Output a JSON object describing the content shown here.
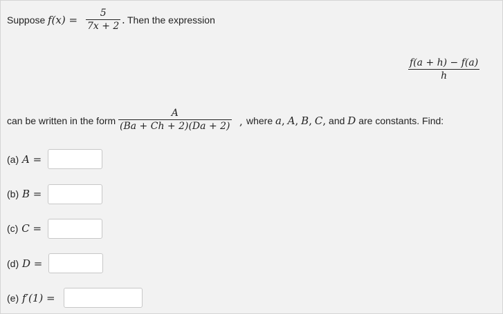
{
  "intro": {
    "text_suppose": "Suppose",
    "f_of_x": "f(x) =",
    "f_numerator": "5",
    "f_denominator": "7x + 2",
    "period": ".",
    "text_then": "Then the expression"
  },
  "expression": {
    "numerator": "f(a + h) − f(a)",
    "denominator": "h"
  },
  "form": {
    "text_can_be": "can be written in the form",
    "numerator": "A",
    "denominator": "(Ba + Ch + 2)(Da + 2)",
    "comma": ",",
    "text_where": "where",
    "var_a": "a",
    "var_A": "A",
    "var_B": "B",
    "var_C": "C",
    "var_D": "D",
    "sep1": ",",
    "sep2": ",",
    "sep3": ",",
    "text_and": "and",
    "text_constants": "are constants. Find:"
  },
  "parts": [
    {
      "prefix": "(a)",
      "var": "A =",
      "value": ""
    },
    {
      "prefix": "(b)",
      "var": "B =",
      "value": ""
    },
    {
      "prefix": "(c)",
      "var": "C =",
      "value": ""
    },
    {
      "prefix": "(d)",
      "var": "D =",
      "value": ""
    },
    {
      "prefix": "(e)",
      "var": "f′(1) =",
      "value": ""
    }
  ]
}
